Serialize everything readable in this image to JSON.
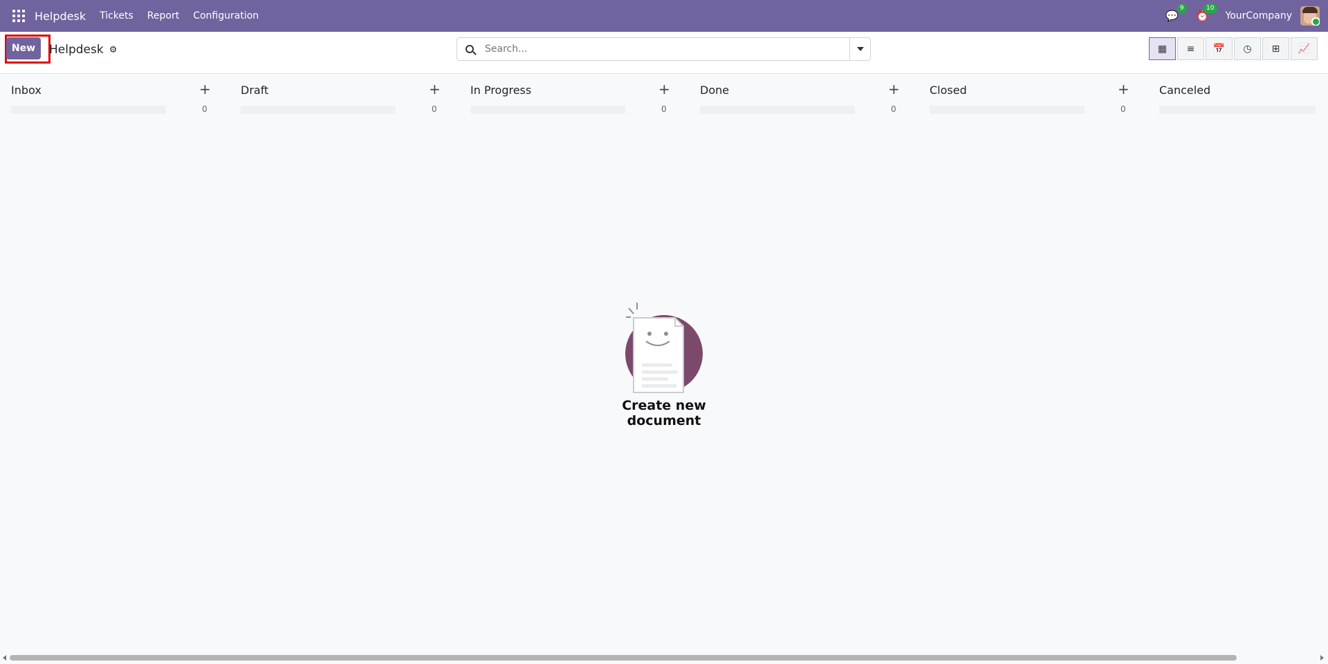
{
  "app": {
    "brand": "Helpdesk"
  },
  "topbar": {
    "menu": [
      "Tickets",
      "Report",
      "Configuration"
    ],
    "messages_count": "9",
    "activity_count": "10",
    "company": "YourCompany"
  },
  "control": {
    "new_label": "New",
    "breadcrumb": "Helpdesk",
    "search_placeholder": "Search..."
  },
  "views": [
    "kanban-icon",
    "list-icon",
    "calendar-icon",
    "activity-icon",
    "pivot-icon",
    "graph-icon"
  ],
  "kanban": {
    "columns": [
      {
        "title": "Inbox",
        "count": "0"
      },
      {
        "title": "Draft",
        "count": "0"
      },
      {
        "title": "In Progress",
        "count": "0"
      },
      {
        "title": "Done",
        "count": "0"
      },
      {
        "title": "Closed",
        "count": "0"
      },
      {
        "title": "Canceled",
        "count": ""
      }
    ]
  },
  "empty_state": {
    "text": "Create new document"
  },
  "colors": {
    "primary": "#71639e",
    "accent_circle": "#7b4a6b",
    "badge": "#28a745",
    "highlight": "#e30000"
  }
}
